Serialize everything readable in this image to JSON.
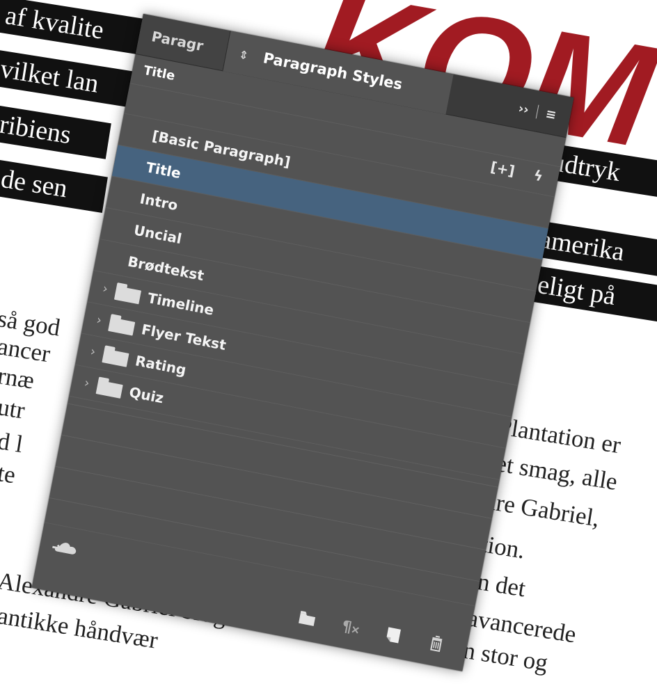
{
  "document": {
    "headline_fragment": "KOM",
    "bands": [
      {
        "text": "e af kvalite"
      },
      {
        "text": "hvilket lan"
      },
      {
        "text": "aribiens"
      },
      {
        "text": "nde sen"
      },
      {
        "text": "udtryk"
      },
      {
        "text": "amerika"
      },
      {
        "text": "geligt på"
      }
    ],
    "body_lines": [
      {
        "text": "så god"
      },
      {
        "text": "ancer"
      },
      {
        "text": "rnæ"
      },
      {
        "text": "utr"
      },
      {
        "text": "d l"
      },
      {
        "text": "te"
      },
      {
        "text": "Plantation er"
      },
      {
        "text": "et smag, alle"
      },
      {
        "text": "dre Gabriel,"
      },
      {
        "text": "ektion."
      },
      {
        "text": "han det"
      },
      {
        "text": "est avancerede"
      },
      {
        "text": "at en stor og"
      },
      {
        "text": "Alexandre Gabriel bruger dis"
      },
      {
        "text": "antikke håndvær"
      }
    ]
  },
  "panel": {
    "tabs": [
      {
        "label": "Paragr"
      },
      {
        "label": "Paragraph Styles"
      }
    ],
    "current_style": "Title",
    "styles": [
      {
        "label": "[Basic Paragraph]",
        "type": "style",
        "selected": false
      },
      {
        "label": "Title",
        "type": "style",
        "selected": true
      },
      {
        "label": "Intro",
        "type": "style",
        "selected": false
      },
      {
        "label": "Uncial",
        "type": "style",
        "selected": false
      },
      {
        "label": "Brødtekst",
        "type": "style",
        "selected": false
      },
      {
        "label": "Timeline",
        "type": "folder",
        "selected": false
      },
      {
        "label": "Flyer Tekst",
        "type": "folder",
        "selected": false
      },
      {
        "label": "Rating",
        "type": "folder",
        "selected": false
      },
      {
        "label": "Quiz",
        "type": "folder",
        "selected": false
      }
    ],
    "icons": {
      "tab_updown": "updown-arrow-icon",
      "expand": "double-chevron-icon",
      "menu": "hamburger-menu-icon",
      "new_style": "plus-box-icon",
      "clear_override": "lightning-icon",
      "cloud": "cloud-sync-icon",
      "new_group": "folder-icon",
      "clear_overrides_footer": "paragraph-clear-icon",
      "new_style_footer": "new-page-icon",
      "delete": "trash-icon"
    },
    "colors": {
      "panel_bg": "#535353",
      "tabbar_bg": "#3a3a3a",
      "selection": "#46637f",
      "headline_red": "#a11b22"
    }
  }
}
